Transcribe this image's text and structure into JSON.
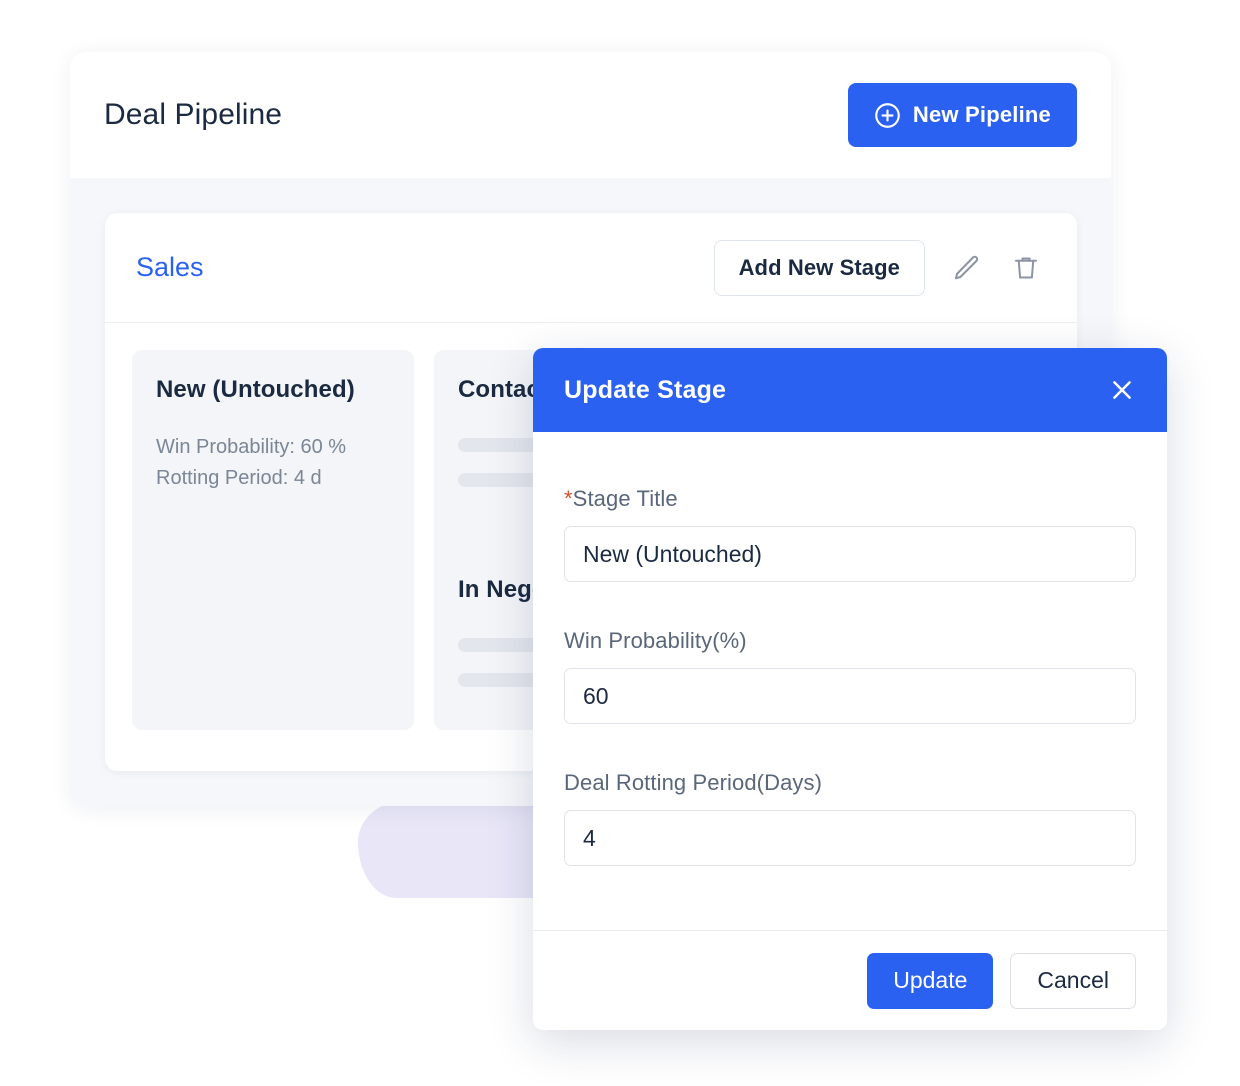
{
  "page": {
    "title": "Deal Pipeline"
  },
  "header": {
    "title": "Deal Pipeline",
    "new_pipeline_label": "New Pipeline",
    "new_pipeline_icon": "plus-circle-icon"
  },
  "pipeline": {
    "name": "Sales",
    "add_stage_label": "Add New Stage",
    "edit_icon": "pencil-icon",
    "delete_icon": "trash-icon",
    "stages": [
      {
        "title": "New (Untouched)",
        "meta_line_1": "Win Probability: 60 %",
        "meta_line_2": "Rotting Period: 4 d",
        "has_meta": true
      },
      {
        "title": "Contacted",
        "has_meta": false
      },
      {
        "title": "In Negotiation",
        "has_meta": false
      }
    ]
  },
  "modal": {
    "title": "Update Stage",
    "close_icon": "close-x-icon",
    "fields": {
      "stage_title": {
        "label": "Stage Title",
        "required_marker": "*",
        "value": "New (Untouched)",
        "placeholder": "Stage Title"
      },
      "win_probability": {
        "label": "Win Probability(%)",
        "value": "60",
        "placeholder": "Win Probability"
      },
      "rotting_period": {
        "label": "Deal Rotting Period(Days)",
        "value": "4",
        "placeholder": "Deal Rotting Period"
      }
    },
    "update_label": "Update",
    "cancel_label": "Cancel"
  },
  "colors": {
    "accent_blue": "#2b61f0",
    "panel_bg": "#f5f7fa",
    "stage_bg": "#f3f5f8",
    "text_dark": "#1b2a41",
    "text_muted": "#7b8696",
    "required_red": "#d4502c",
    "blob_purple": "#e8e6f7"
  }
}
